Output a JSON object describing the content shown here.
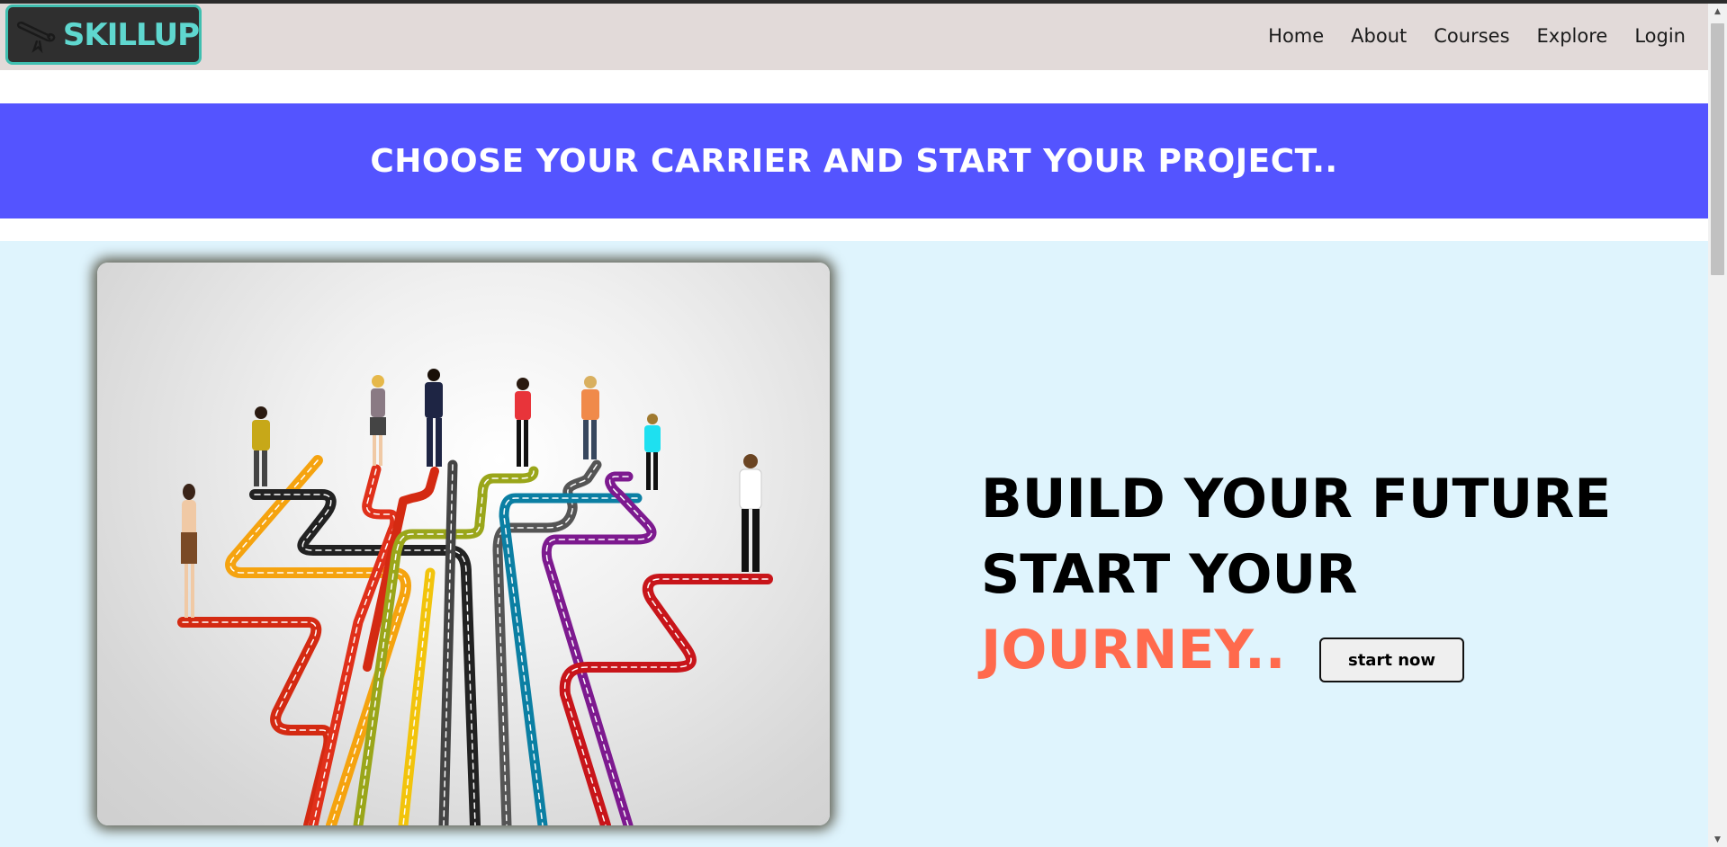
{
  "navbar": {
    "logo_text": "SKILLUP",
    "links": [
      "Home",
      "About",
      "Courses",
      "Explore",
      "Login"
    ]
  },
  "banner": {
    "text": "CHOOSE YOUR CARRIER AND START YOUR PROJECT.."
  },
  "hero": {
    "headline_line1": "BUILD YOUR FUTURE",
    "headline_line2_start": "START YOUR ",
    "headline_line2_accent": "JOURNEY..",
    "button_label": "start now"
  },
  "colors": {
    "navbar_bg": "#e2dad9",
    "logo_bg": "#2f2f2f",
    "logo_accent": "#5fd7cf",
    "banner_bg": "#5454ff",
    "hero_bg": "#dff4fd",
    "accent": "#ff6a4d"
  },
  "icons": {
    "logo": "diploma-scroll-icon",
    "scroll_up": "triangle-up-icon",
    "scroll_down": "triangle-down-icon"
  }
}
